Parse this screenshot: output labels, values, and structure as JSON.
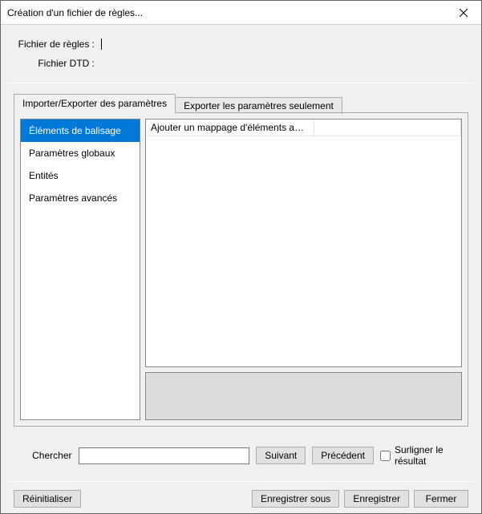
{
  "window": {
    "title": "Création d'un fichier de règles..."
  },
  "files": {
    "rules_label": "Fichier de règles :",
    "dtd_label": "Fichier DTD :",
    "rules_value": "",
    "dtd_value": ""
  },
  "tabs": {
    "items": [
      {
        "label": "Importer/Exporter des paramètres"
      },
      {
        "label": "Exporter les paramètres seulement"
      }
    ]
  },
  "sidebar": {
    "items": [
      {
        "label": "Éléments de balisage"
      },
      {
        "label": "Paramètres globaux"
      },
      {
        "label": "Entités"
      },
      {
        "label": "Paramètres avancés"
      }
    ]
  },
  "grid": {
    "col1_header": "Ajouter un mappage d'éléments avec ...",
    "col2_header": ""
  },
  "search": {
    "label": "Chercher",
    "value": "",
    "next": "Suivant",
    "prev": "Précédent",
    "highlight": "Surligner le résultat"
  },
  "buttons": {
    "reset": "Réinitialiser",
    "save_as": "Enregistrer sous",
    "save": "Enregistrer",
    "close": "Fermer"
  }
}
